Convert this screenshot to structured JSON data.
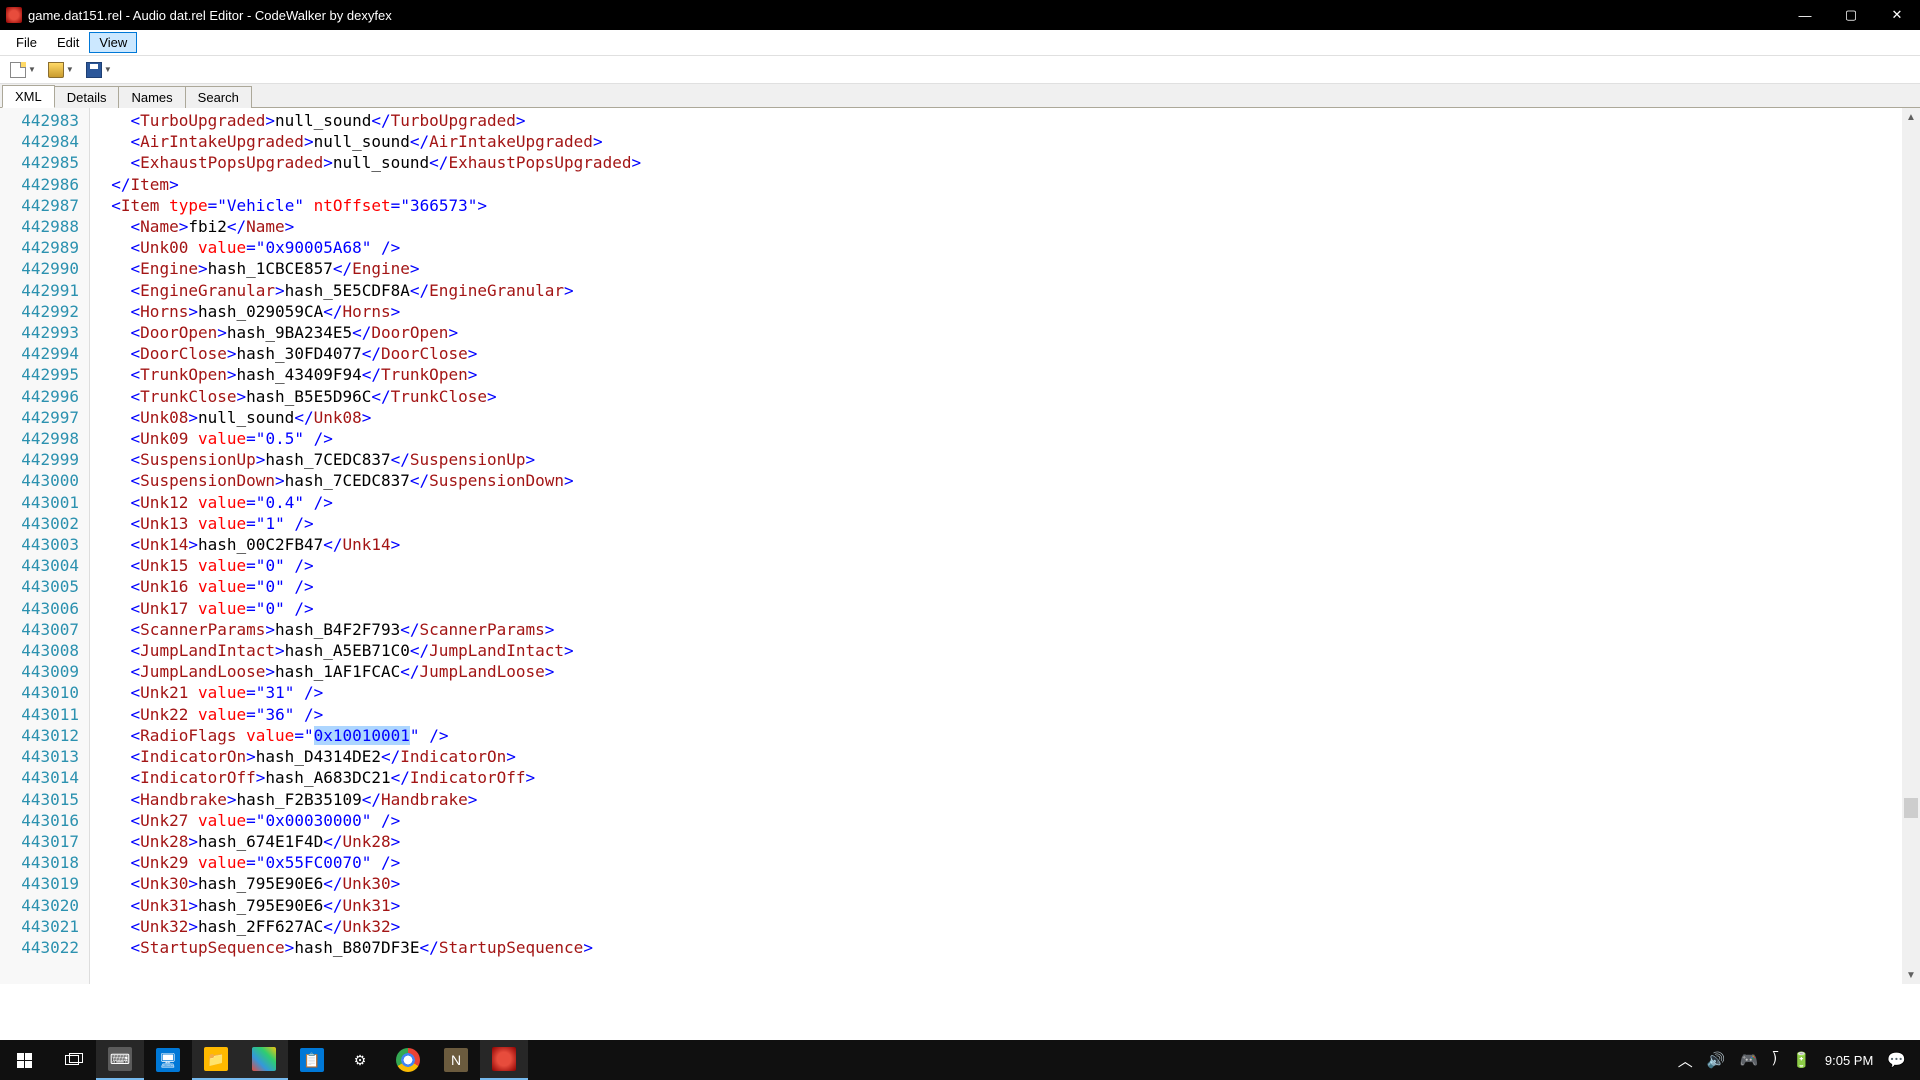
{
  "window": {
    "title": "game.dat151.rel - Audio dat.rel Editor - CodeWalker by dexyfex"
  },
  "menu": {
    "file": "File",
    "edit": "Edit",
    "view": "View"
  },
  "tabs": {
    "xml": "XML",
    "details": "Details",
    "names": "Names",
    "search": "Search"
  },
  "line_start": 442983,
  "code_lines": [
    {
      "i": 2,
      "type": "elem",
      "tag": "TurboUpgraded",
      "text": "null_sound"
    },
    {
      "i": 2,
      "type": "elem",
      "tag": "AirIntakeUpgraded",
      "text": "null_sound"
    },
    {
      "i": 2,
      "type": "elem",
      "tag": "ExhaustPopsUpgraded",
      "text": "null_sound"
    },
    {
      "i": 1,
      "type": "close",
      "tag": "Item"
    },
    {
      "i": 1,
      "type": "open",
      "tag": "Item",
      "attrs": [
        [
          "type",
          "Vehicle"
        ],
        [
          "ntOffset",
          "366573"
        ]
      ]
    },
    {
      "i": 2,
      "type": "elem",
      "tag": "Name",
      "text": "fbi2"
    },
    {
      "i": 2,
      "type": "self",
      "tag": "Unk00",
      "attrs": [
        [
          "value",
          "0x90005A68"
        ]
      ]
    },
    {
      "i": 2,
      "type": "elem",
      "tag": "Engine",
      "text": "hash_1CBCE857"
    },
    {
      "i": 2,
      "type": "elem",
      "tag": "EngineGranular",
      "text": "hash_5E5CDF8A"
    },
    {
      "i": 2,
      "type": "elem",
      "tag": "Horns",
      "text": "hash_029059CA"
    },
    {
      "i": 2,
      "type": "elem",
      "tag": "DoorOpen",
      "text": "hash_9BA234E5"
    },
    {
      "i": 2,
      "type": "elem",
      "tag": "DoorClose",
      "text": "hash_30FD4077"
    },
    {
      "i": 2,
      "type": "elem",
      "tag": "TrunkOpen",
      "text": "hash_43409F94"
    },
    {
      "i": 2,
      "type": "elem",
      "tag": "TrunkClose",
      "text": "hash_B5E5D96C"
    },
    {
      "i": 2,
      "type": "elem",
      "tag": "Unk08",
      "text": "null_sound"
    },
    {
      "i": 2,
      "type": "self",
      "tag": "Unk09",
      "attrs": [
        [
          "value",
          "0.5"
        ]
      ]
    },
    {
      "i": 2,
      "type": "elem",
      "tag": "SuspensionUp",
      "text": "hash_7CEDC837"
    },
    {
      "i": 2,
      "type": "elem",
      "tag": "SuspensionDown",
      "text": "hash_7CEDC837"
    },
    {
      "i": 2,
      "type": "self",
      "tag": "Unk12",
      "attrs": [
        [
          "value",
          "0.4"
        ]
      ]
    },
    {
      "i": 2,
      "type": "self",
      "tag": "Unk13",
      "attrs": [
        [
          "value",
          "1"
        ]
      ]
    },
    {
      "i": 2,
      "type": "elem",
      "tag": "Unk14",
      "text": "hash_00C2FB47"
    },
    {
      "i": 2,
      "type": "self",
      "tag": "Unk15",
      "attrs": [
        [
          "value",
          "0"
        ]
      ]
    },
    {
      "i": 2,
      "type": "self",
      "tag": "Unk16",
      "attrs": [
        [
          "value",
          "0"
        ]
      ]
    },
    {
      "i": 2,
      "type": "self",
      "tag": "Unk17",
      "attrs": [
        [
          "value",
          "0"
        ]
      ]
    },
    {
      "i": 2,
      "type": "elem",
      "tag": "ScannerParams",
      "text": "hash_B4F2F793"
    },
    {
      "i": 2,
      "type": "elem",
      "tag": "JumpLandIntact",
      "text": "hash_A5EB71C0"
    },
    {
      "i": 2,
      "type": "elem",
      "tag": "JumpLandLoose",
      "text": "hash_1AF1FCAC"
    },
    {
      "i": 2,
      "type": "self",
      "tag": "Unk21",
      "attrs": [
        [
          "value",
          "31"
        ]
      ]
    },
    {
      "i": 2,
      "type": "self",
      "tag": "Unk22",
      "attrs": [
        [
          "value",
          "36"
        ]
      ]
    },
    {
      "i": 2,
      "type": "self",
      "tag": "RadioFlags",
      "attrs": [
        [
          "value",
          "0x10010001"
        ]
      ],
      "sel_val": 0
    },
    {
      "i": 2,
      "type": "elem",
      "tag": "IndicatorOn",
      "text": "hash_D4314DE2"
    },
    {
      "i": 2,
      "type": "elem",
      "tag": "IndicatorOff",
      "text": "hash_A683DC21"
    },
    {
      "i": 2,
      "type": "elem",
      "tag": "Handbrake",
      "text": "hash_F2B35109"
    },
    {
      "i": 2,
      "type": "self",
      "tag": "Unk27",
      "attrs": [
        [
          "value",
          "0x00030000"
        ]
      ]
    },
    {
      "i": 2,
      "type": "elem",
      "tag": "Unk28",
      "text": "hash_674E1F4D"
    },
    {
      "i": 2,
      "type": "self",
      "tag": "Unk29",
      "attrs": [
        [
          "value",
          "0x55FC0070"
        ]
      ]
    },
    {
      "i": 2,
      "type": "elem",
      "tag": "Unk30",
      "text": "hash_795E90E6"
    },
    {
      "i": 2,
      "type": "elem",
      "tag": "Unk31",
      "text": "hash_795E90E6"
    },
    {
      "i": 2,
      "type": "elem",
      "tag": "Unk32",
      "text": "hash_2FF627AC"
    },
    {
      "i": 2,
      "type": "elem",
      "tag": "StartupSequence",
      "text": "hash_B807DF3E"
    }
  ],
  "taskbar": {
    "time": "9:05 PM"
  }
}
